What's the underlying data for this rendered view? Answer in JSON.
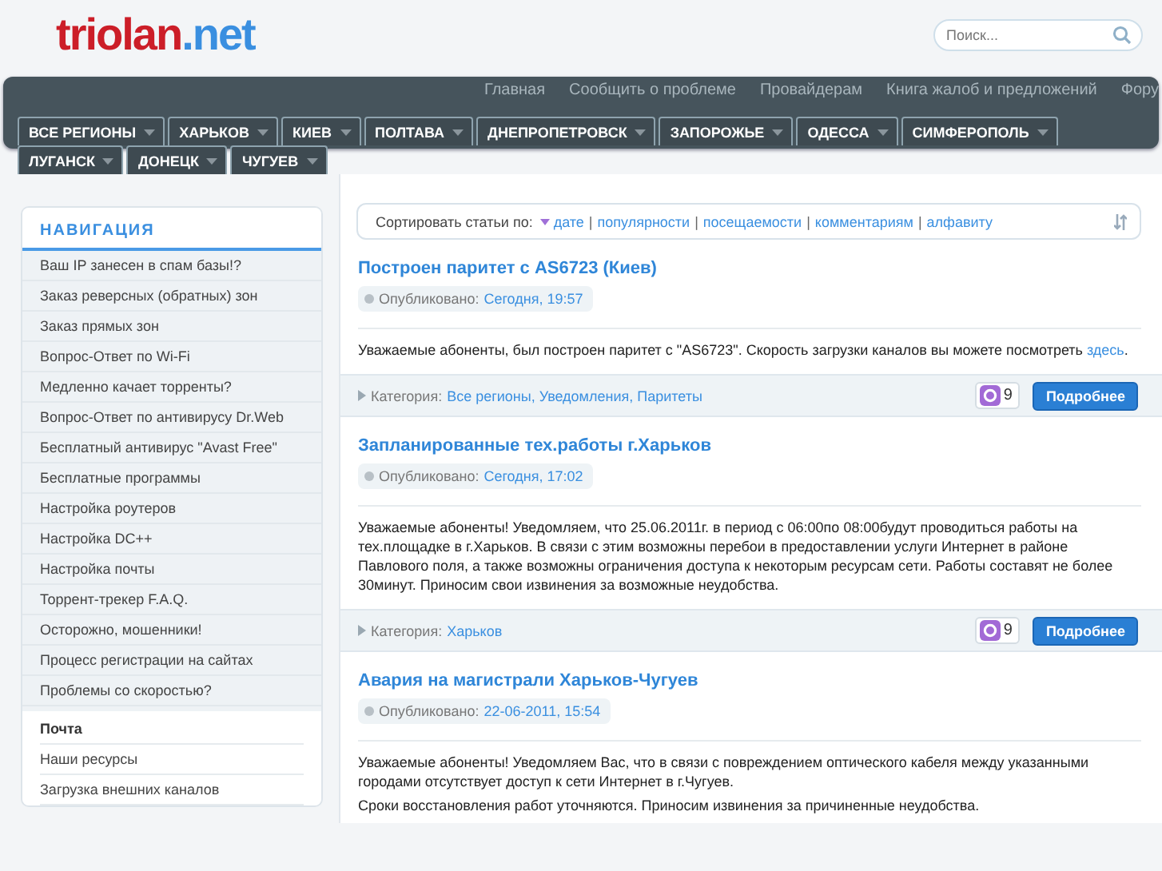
{
  "header": {
    "logo_left": "triolan",
    "logo_right": ".net",
    "search": {
      "placeholder": "Поиск..."
    }
  },
  "top_links": [
    "Главная",
    "Сообщить о проблеме",
    "Провайдерам",
    "Книга жалоб и предложений",
    "Фору"
  ],
  "regions": [
    {
      "label": "ВСЕ РЕГИОНЫ"
    },
    {
      "label": "ХАРЬКОВ"
    },
    {
      "label": "КИЕВ"
    },
    {
      "label": "ПОЛТАВА"
    },
    {
      "label": "ДНЕПРОПЕТРОВСК"
    },
    {
      "label": "ЗАПОРОЖЬЕ"
    },
    {
      "label": "ОДЕССА"
    },
    {
      "label": "СИМФЕРОПОЛЬ"
    },
    {
      "label": "ЛУГАНСК"
    },
    {
      "label": "ДОНЕЦК"
    },
    {
      "label": "ЧУГУЕВ"
    }
  ],
  "sidebar": {
    "title": "НАВИГАЦИЯ",
    "items": [
      "Ваш IP занесен в спам базы!?",
      "Заказ реверсных (обратных) зон",
      "Заказ прямых зон",
      "Вопрос-Ответ по Wi-Fi",
      "Медленно качает торренты?",
      "Вопрос-Ответ по антивирусу Dr.Web",
      "Бесплатный антивирус \"Avast Free\"",
      "Бесплатные программы",
      "Настройка роутеров",
      "Настройка DC++",
      "Настройка почты",
      "Торрент-трекер F.A.Q.",
      "Осторожно, мошенники!",
      "Процесс регистрации на сайтах",
      "Проблемы со скоростью?"
    ],
    "block_title": "Почта",
    "block_items": [
      "Наши ресурсы",
      "Загрузка внешних каналов"
    ]
  },
  "sort": {
    "label": "Сортировать статьи по:",
    "separator": "|",
    "options": [
      {
        "label": "дате",
        "selected": true
      },
      {
        "label": "популярности",
        "selected": false
      },
      {
        "label": "посещаемости",
        "selected": false
      },
      {
        "label": "комментариям",
        "selected": false
      },
      {
        "label": "алфавиту",
        "selected": false
      }
    ]
  },
  "articles": [
    {
      "title": "Построен паритет с AS6723 (Киев)",
      "date_label": "Опубликовано:",
      "date": "Сегодня, 19:57",
      "paragraphs": [
        [
          {
            "kind": "text",
            "text": "Уважаемые абоненты, был построен паритет с \"AS6723\". Скорость загрузки каналов вы можете посмотреть "
          },
          {
            "kind": "link",
            "text": "здесь"
          },
          {
            "kind": "text",
            "text": "."
          }
        ]
      ],
      "footer": {
        "category_label": "Категория:",
        "categories": "Все регионы, Уведомления, Паритеты",
        "comments": "9",
        "more": "Подробнее"
      }
    },
    {
      "title": "Запланированные тех.работы г.Харьков",
      "date_label": "Опубликовано:",
      "date": "Сегодня, 17:02",
      "paragraphs": [
        [
          {
            "kind": "text",
            "text": "Уважаемые абоненты! Уведомляем, что  25.06.2011г. в период с  06:00по  08:00будут проводиться работы на тех.площадке в г.Харьков. В связи с этим возможны перебои в предоставлении услуги Интернет в районе Павлового поля, а также возможны ограничения доступа к некоторым ресурсам сети. Работы составят не более  30минут. Приносим свои извинения за возможные неудобства."
          }
        ]
      ],
      "footer": {
        "category_label": "Категория:",
        "categories": "Харьков",
        "comments": "9",
        "more": "Подробнее"
      }
    },
    {
      "title": "Авария на магистрали Харьков-Чугуев",
      "date_label": "Опубликовано:",
      "date": "22-06-2011, 15:54",
      "paragraphs": [
        [
          {
            "kind": "text",
            "text": "Уважаемые абоненты! Уведомляем Вас, что в связи с повреждением           оптического кабеля между указанными городами отсутствует доступ к сети Интернет в г.Чугуев."
          }
        ],
        [
          {
            "kind": "text",
            "text": "Сроки восстановления работ уточняются. Приносим извинения за причиненные неудобства."
          }
        ]
      ]
    }
  ]
}
